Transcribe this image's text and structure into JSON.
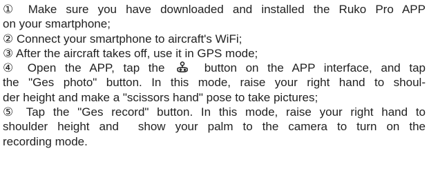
{
  "instructions": [
    {
      "number": "①",
      "lines": [
        "Make sure you have downloaded and installed the Ruko Pro APP",
        "on your smartphone;"
      ]
    },
    {
      "number": "②",
      "lines": [
        "Connect your smartphone to aircraft's WiFi;"
      ]
    },
    {
      "number": "③",
      "lines": [
        "After the aircraft takes off, use it in GPS mode;"
      ]
    },
    {
      "number": "④",
      "line1_before_icon": "Open the APP, tap the",
      "icon": "gesture-joystick-icon",
      "line1_after_icon": "button on the APP interface, and tap",
      "lines_rest": [
        "the \"Ges photo\" button. In this mode, raise your right hand to shoul-",
        "der height and make a \"scissors hand\" pose to take pictures;"
      ]
    },
    {
      "number": "⑤",
      "lines": [
        "Tap the \"Ges record\" button. In this mode, raise your right hand to",
        "shoulder height and  show your palm to the camera to turn on the",
        "recording mode."
      ]
    }
  ]
}
